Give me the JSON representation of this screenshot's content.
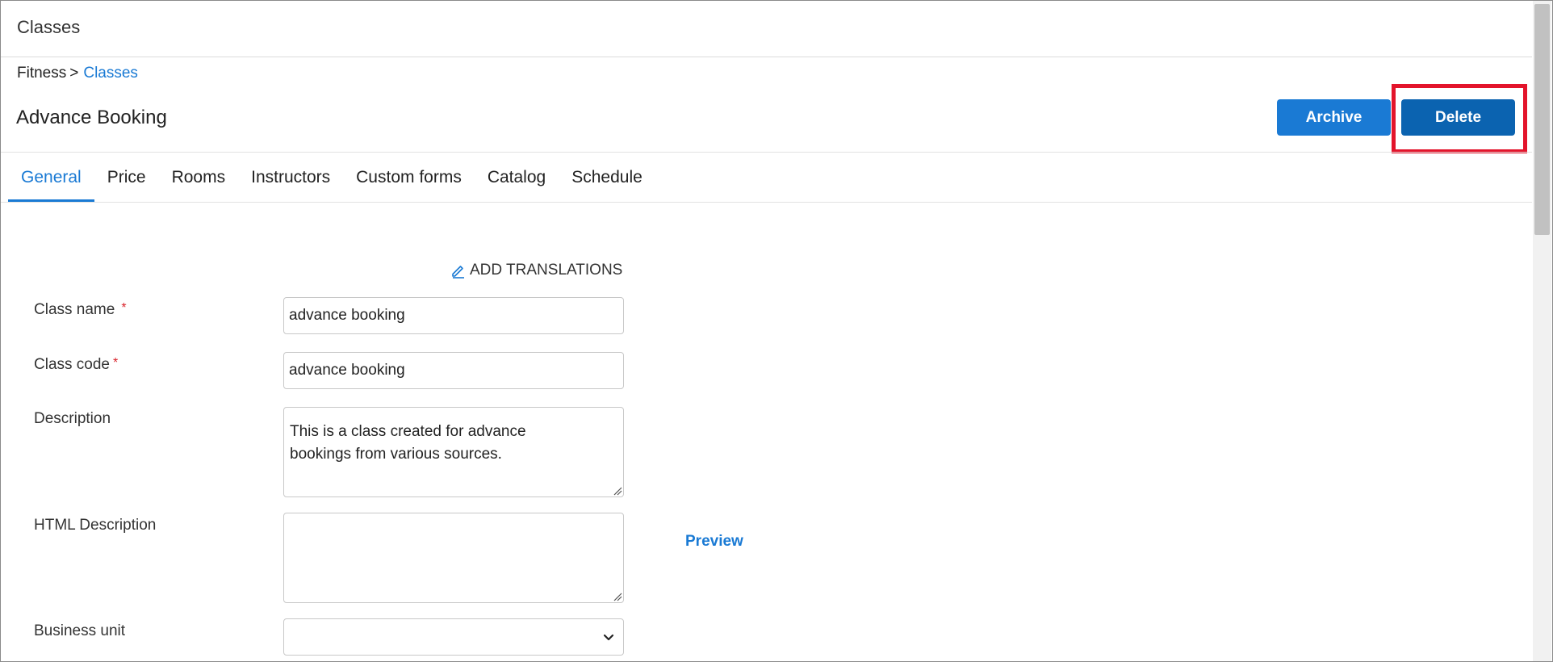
{
  "header": {
    "title": "Classes"
  },
  "breadcrumb": {
    "root": "Fitness",
    "separator": ">",
    "current": "Classes"
  },
  "page": {
    "title": "Advance Booking"
  },
  "actions": {
    "archive_label": "Archive",
    "delete_label": "Delete"
  },
  "tabs": [
    {
      "label": "General",
      "active": true
    },
    {
      "label": "Price"
    },
    {
      "label": "Rooms"
    },
    {
      "label": "Instructors"
    },
    {
      "label": "Custom forms"
    },
    {
      "label": "Catalog"
    },
    {
      "label": "Schedule"
    }
  ],
  "form": {
    "add_translations": "ADD TRANSLATIONS",
    "class_name": {
      "label": "Class name",
      "required_mark": "*",
      "value": "advance booking"
    },
    "class_code": {
      "label": "Class code",
      "required_mark": "*",
      "value": "advance booking"
    },
    "description": {
      "label": "Description",
      "value": "This is a class created for advance\nbookings from various sources."
    },
    "html_description": {
      "label": "HTML Description",
      "value": "",
      "preview_label": "Preview"
    },
    "business_unit": {
      "label": "Business unit",
      "value": ""
    }
  },
  "colors": {
    "accent": "#1a7ad4",
    "delete": "#0b63b0",
    "highlight": "#e3142b",
    "required": "#d9222a"
  },
  "icons": [
    "pencil-icon",
    "chevron-down-icon",
    "resize-grip-icon"
  ]
}
